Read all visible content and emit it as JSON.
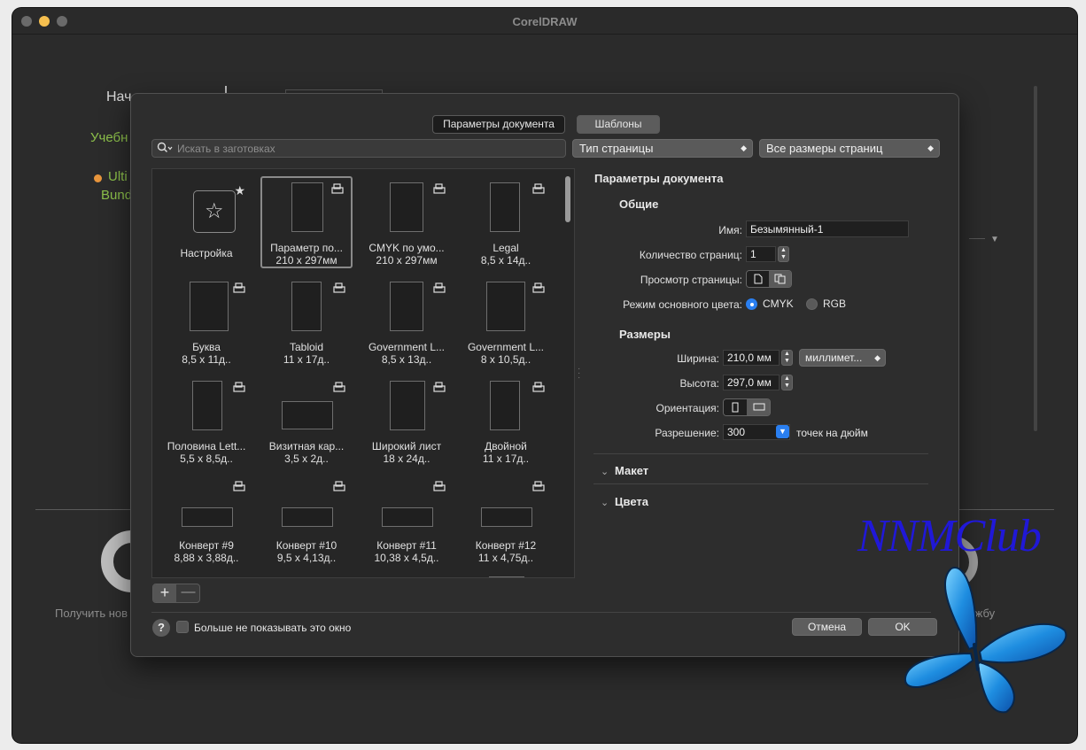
{
  "app": {
    "title": "CorelDRAW"
  },
  "background": {
    "start_label": "Нач",
    "learn_label": "Учебн",
    "ulti_label": "Ulti",
    "bund_label": "Bund",
    "get_label": "Получить нов",
    "service_label": "ужбу"
  },
  "dialog": {
    "tabs": [
      {
        "label": "Параметры документа",
        "active": true
      },
      {
        "label": "Шаблоны",
        "active": false
      }
    ],
    "search": {
      "placeholder": "Искать в заготовках",
      "icon": "search-icon"
    },
    "page_type_select": {
      "value": "Тип страницы"
    },
    "page_sizes_select": {
      "value": "Все размеры страниц"
    },
    "templates": [
      {
        "name": "Настройка",
        "size": "",
        "kind": "custom"
      },
      {
        "name": "Параметр по...",
        "size": "210 x 297мм",
        "selected": true
      },
      {
        "name": "CMYK по умо...",
        "size": "210 x 297мм"
      },
      {
        "name": "Legal",
        "size": "8,5 x 14д.."
      },
      {
        "name": "Буква",
        "size": "8,5 x 11д.."
      },
      {
        "name": "Tabloid",
        "size": "11 x 17д.."
      },
      {
        "name": "Government L...",
        "size": "8,5 x 13д.."
      },
      {
        "name": "Government L...",
        "size": "8 x 10,5д.."
      },
      {
        "name": "Половина Lett...",
        "size": "5,5 x 8,5д.."
      },
      {
        "name": "Визитная кар...",
        "size": "3,5 x 2д.."
      },
      {
        "name": "Широкий лист",
        "size": "18 x 24д.."
      },
      {
        "name": "Двойной",
        "size": "11 x 17д.."
      },
      {
        "name": "Конверт #9",
        "size": "8,88 x 3,88д.."
      },
      {
        "name": "Конверт #10",
        "size": "9,5 x 4,13д.."
      },
      {
        "name": "Конверт #11",
        "size": "10,38 x 4,5д.."
      },
      {
        "name": "Конверт #12",
        "size": "11 x 4,75д.."
      }
    ],
    "settings": {
      "title": "Параметры документа",
      "general_title": "Общие",
      "name_label": "Имя:",
      "name_value": "Безымянный-1",
      "pages_label": "Количество страниц:",
      "pages_value": "1",
      "preview_label": "Просмотр страницы:",
      "color_mode_label": "Режим основного цвета:",
      "color_mode_options": [
        "CMYK",
        "RGB"
      ],
      "color_mode_selected": "CMYK",
      "sizes_title": "Размеры",
      "width_label": "Ширина:",
      "width_value": "210,0 мм",
      "units_value": "миллимет...",
      "height_label": "Высота:",
      "height_value": "297,0 мм",
      "orientation_label": "Ориентация:",
      "orientation_selected": "portrait",
      "resolution_label": "Разрешение:",
      "resolution_value": "300",
      "resolution_unit": "точек на дюйм",
      "layout_section": "Макет",
      "colors_section": "Цвета"
    },
    "footer": {
      "dont_show_label": "Больше не показывать это окно",
      "dont_show_checked": false,
      "cancel_label": "Отмена",
      "ok_label": "OK",
      "help_label": "?"
    }
  },
  "watermark": {
    "text": "NNMClub"
  },
  "colors": {
    "accent": "#2a7ff0",
    "watermark": "#2018d8",
    "traffic_min": "#f5bf4f"
  }
}
